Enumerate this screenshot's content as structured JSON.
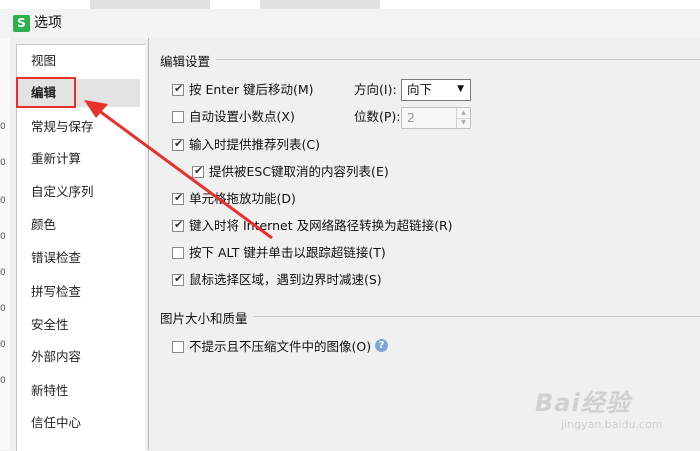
{
  "window": {
    "title": "选项",
    "app_icon_letter": "S"
  },
  "edge_digits": [
    "0",
    "0",
    "0",
    "0",
    "0",
    "0",
    "0",
    "0"
  ],
  "sidebar": {
    "items": [
      {
        "label": "视图",
        "selected": false
      },
      {
        "label": "编辑",
        "selected": true
      },
      {
        "label": "常规与保存",
        "selected": false
      },
      {
        "label": "重新计算",
        "selected": false
      },
      {
        "label": "自定义序列",
        "selected": false
      },
      {
        "label": "颜色",
        "selected": false
      },
      {
        "label": "错误检查",
        "selected": false
      },
      {
        "label": "拼写检查",
        "selected": false
      },
      {
        "label": "安全性",
        "selected": false
      },
      {
        "label": "外部内容",
        "selected": false
      },
      {
        "label": "新特性",
        "selected": false
      },
      {
        "label": "信任中心",
        "selected": false
      }
    ]
  },
  "edit_settings": {
    "section_title": "编辑设置",
    "move_after_enter": {
      "label": "按 Enter 键后移动(M)",
      "checked": true
    },
    "direction": {
      "label": "方向(I):",
      "value": "向下"
    },
    "auto_decimal": {
      "label": "自动设置小数点(X)",
      "checked": false
    },
    "places": {
      "label": "位数(P):",
      "value": "2"
    },
    "autocomplete_list": {
      "label": "输入时提供推荐列表(C)",
      "checked": true
    },
    "esc_cancel_list": {
      "label": "提供被ESC键取消的内容列表(E)",
      "checked": true
    },
    "drag_drop": {
      "label": "单元格拖放功能(D)",
      "checked": true
    },
    "internet_hyperlink": {
      "label": "键入时将 Internet 及网络路径转换为超链接(R)",
      "checked": true
    },
    "alt_click_link": {
      "label": "按下 ALT 键并单击以跟踪超链接(T)",
      "checked": false
    },
    "mouse_slowdown": {
      "label": "鼠标选择区域，遇到边界时减速(S)",
      "checked": true
    }
  },
  "image_settings": {
    "section_title": "图片大小和质量",
    "no_compress": {
      "label": "不提示且不压缩文件中的图像(O)",
      "checked": false
    },
    "help_icon": "?"
  },
  "watermark": {
    "brand": "Bai经验",
    "url": "jingyan.baidu.com"
  },
  "annotation": {
    "color": "#e8312b"
  },
  "colors": {
    "accent_red": "#e8312b",
    "app_green": "#2bb24c"
  }
}
